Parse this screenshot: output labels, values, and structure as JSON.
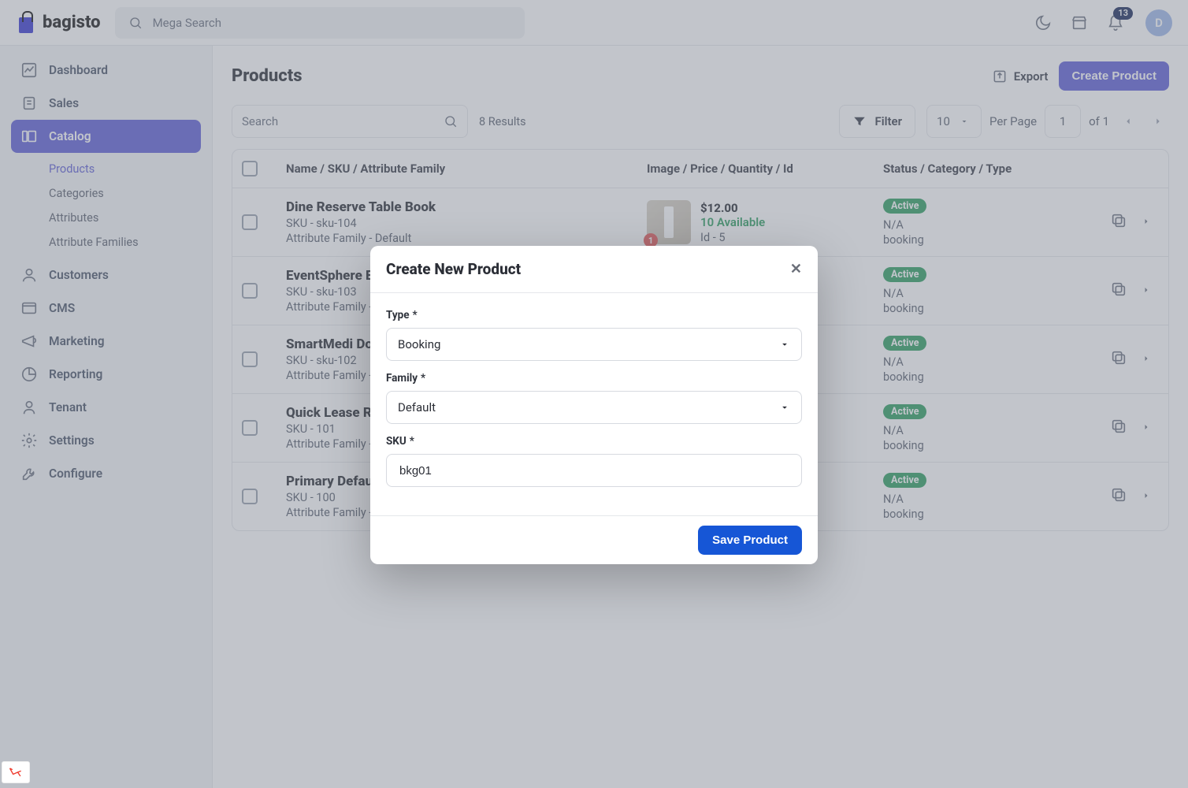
{
  "brand": "bagisto",
  "header": {
    "search_placeholder": "Mega Search",
    "notif_count": "13",
    "avatar_initial": "D"
  },
  "sidebar": {
    "items": [
      {
        "label": "Dashboard",
        "active": false
      },
      {
        "label": "Sales",
        "active": false
      },
      {
        "label": "Catalog",
        "active": true,
        "children": [
          {
            "label": "Products",
            "active": true
          },
          {
            "label": "Categories",
            "active": false
          },
          {
            "label": "Attributes",
            "active": false
          },
          {
            "label": "Attribute Families",
            "active": false
          }
        ]
      },
      {
        "label": "Customers",
        "active": false
      },
      {
        "label": "CMS",
        "active": false
      },
      {
        "label": "Marketing",
        "active": false
      },
      {
        "label": "Reporting",
        "active": false
      },
      {
        "label": "Tenant",
        "active": false
      },
      {
        "label": "Settings",
        "active": false
      },
      {
        "label": "Configure",
        "active": false
      }
    ]
  },
  "page": {
    "title": "Products",
    "export": "Export",
    "create": "Create Product",
    "search_placeholder": "Search",
    "results": "8 Results",
    "filter": "Filter",
    "per_page_value": "10",
    "per_page_label": "Per Page",
    "page_value": "1",
    "of_label": "of 1",
    "columns": {
      "c1": "Name / SKU / Attribute Family",
      "c2": "Image / Price / Quantity / Id",
      "c3": "Status / Category / Type"
    }
  },
  "rows": [
    {
      "name": "Dine Reserve Table Book",
      "sku": "SKU - sku-104",
      "family": "Attribute Family - Default",
      "price": "$12.00",
      "avail": "10 Available",
      "id": "Id - 5",
      "thumb_count": "1",
      "status": "Active",
      "category": "N/A",
      "type": "booking"
    },
    {
      "name": "EventSphere Even",
      "sku": "SKU - sku-103",
      "family": "Attribute Family - De",
      "status": "Active",
      "category": "N/A",
      "type": "booking"
    },
    {
      "name": "SmartMedi Docto",
      "sku": "SKU - sku-102",
      "family": "Attribute Family - De",
      "status": "Active",
      "category": "N/A",
      "type": "booking"
    },
    {
      "name": "Quick Lease Rent",
      "sku": "SKU - 101",
      "family": "Attribute Family - De",
      "status": "Active",
      "category": "N/A",
      "type": "booking"
    },
    {
      "name": "Primary Default B",
      "sku": "SKU - 100",
      "family": "Attribute Family - De",
      "status": "Active",
      "category": "N/A",
      "type": "booking"
    }
  ],
  "modal": {
    "title": "Create New Product",
    "type_label": "Type",
    "type_value": "Booking",
    "family_label": "Family",
    "family_value": "Default",
    "sku_label": "SKU",
    "sku_value": "bkg01",
    "save": "Save Product",
    "required": "*"
  }
}
